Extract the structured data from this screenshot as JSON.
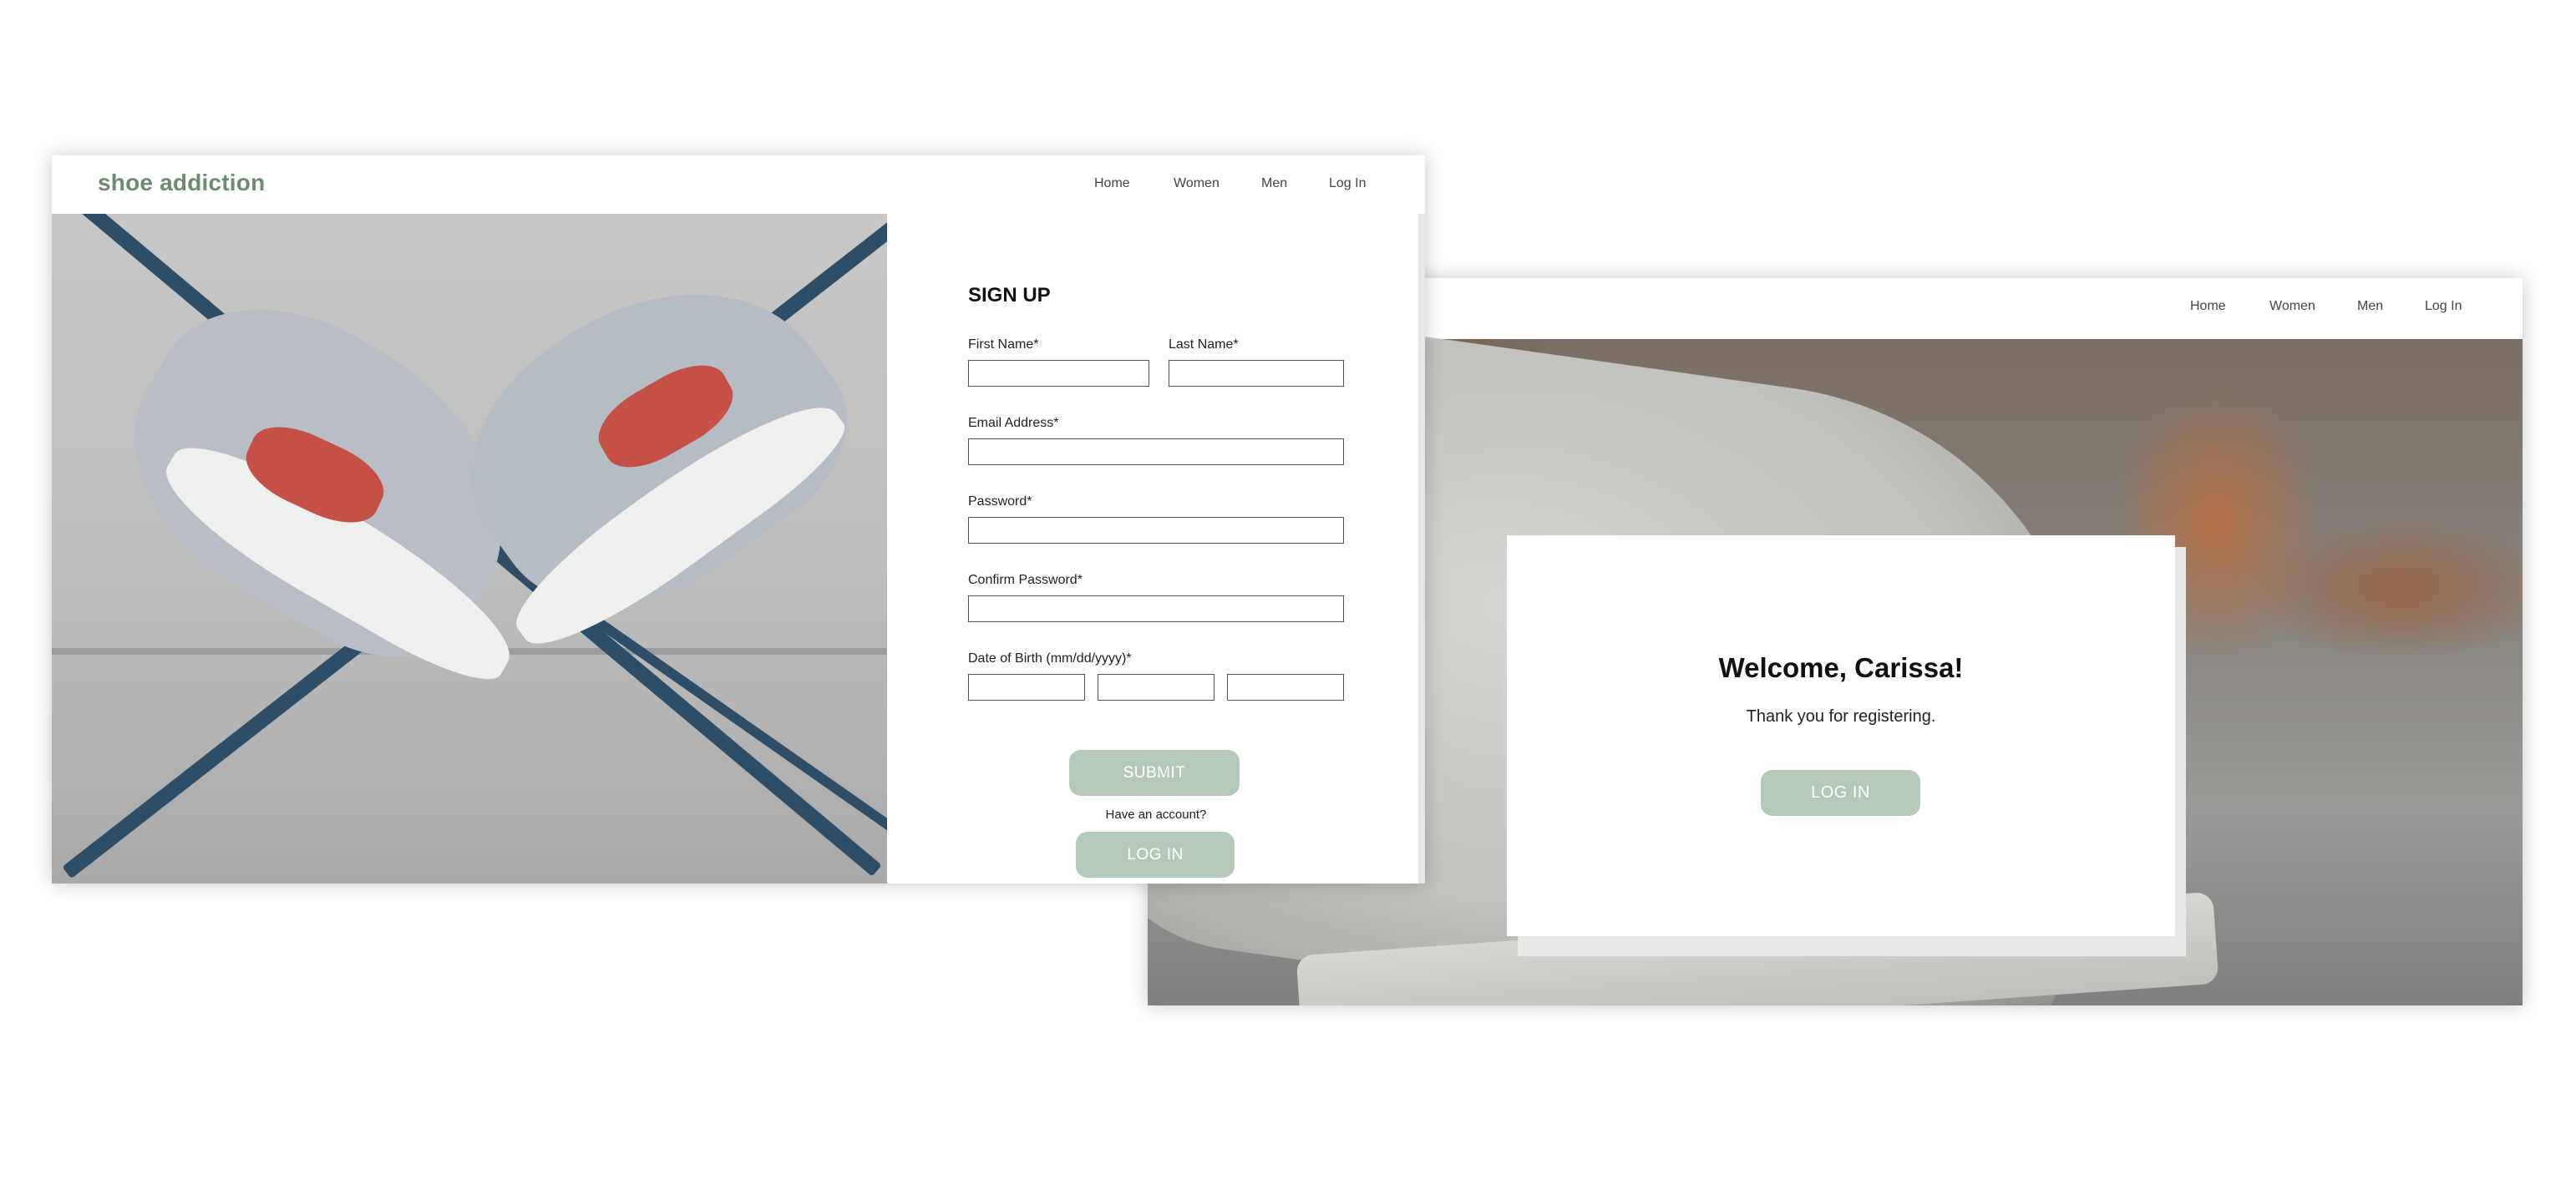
{
  "back_screen": {
    "nav": [
      "Home",
      "Women",
      "Men",
      "Log In"
    ],
    "welcome_title": "Welcome, Carissa!",
    "welcome_message": "Thank you for registering.",
    "login_button": "LOG IN"
  },
  "front_screen": {
    "brand": "shoe addiction",
    "nav": [
      "Home",
      "Women",
      "Men",
      "Log In"
    ],
    "form": {
      "title": "SIGN UP",
      "first_name_label": "First Name*",
      "last_name_label": "Last Name*",
      "email_label": "Email Address*",
      "password_label": "Password*",
      "confirm_password_label": "Confirm Password*",
      "dob_label": "Date of Birth (mm/dd/yyyy)*",
      "submit_button": "SUBMIT",
      "have_account_text": "Have an account?",
      "login_button": "LOG IN"
    }
  },
  "colors": {
    "brand": "#6e8a71",
    "button": "#b4c9b8",
    "button_text": "#ffffff"
  }
}
